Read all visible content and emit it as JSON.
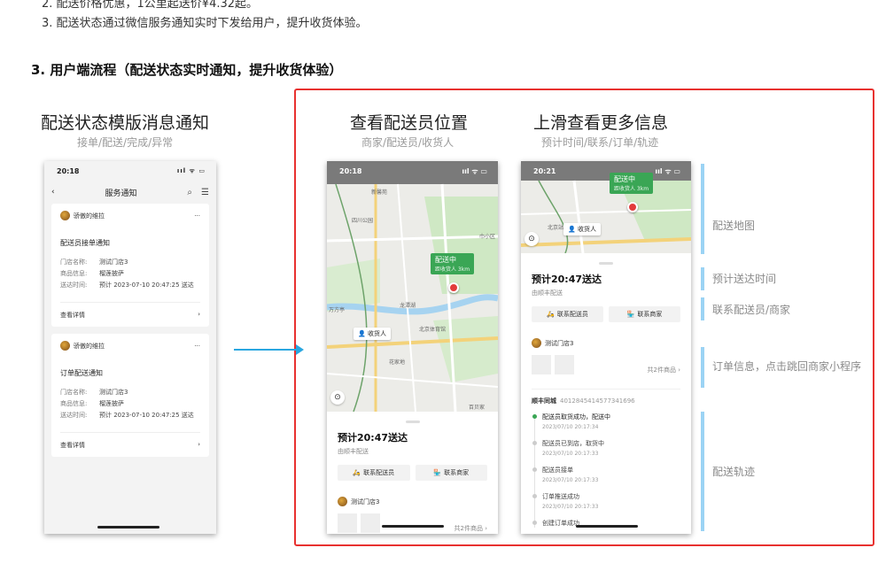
{
  "intro_list": [
    "2. 配送价格优惠，1公里起送价¥4.32起。",
    "3. 配送状态通过微信服务通知实时下发给用户，提升收货体验。"
  ],
  "section_heading": "3. 用户端流程（配送状态实时通知，提升收货体验）",
  "columns": [
    {
      "title": "配送状态模版消息通知",
      "subtitle": "接单/配送/完成/异常"
    },
    {
      "title": "查看配送员位置",
      "subtitle": "商家/配送员/收货人"
    },
    {
      "title": "上滑查看更多信息",
      "subtitle": "预计时间/联系/订单/轨迹"
    }
  ],
  "phone1": {
    "time": "20:18",
    "status_icons": "ııl ᯤ ▭",
    "nav_title": "服务通知",
    "cards": [
      {
        "sender": "骄傲的维拉",
        "more": "···",
        "title": "配送员接单通知",
        "fields": [
          {
            "k": "门店名称:",
            "v": "测试门店3"
          },
          {
            "k": "商品信息:",
            "v": "榴莲披萨"
          },
          {
            "k": "送达时间:",
            "v": "预计 2023-07-10 20:47:25 送达"
          }
        ],
        "footer": "查看详情"
      },
      {
        "sender": "骄傲的维拉",
        "more": "···",
        "title": "订单配送通知",
        "fields": [
          {
            "k": "门店名称:",
            "v": "测试门店3"
          },
          {
            "k": "商品信息:",
            "v": "榴莲披萨"
          },
          {
            "k": "送达时间:",
            "v": "预计 2023-07-10 20:47:25 送达"
          }
        ],
        "footer": "查看详情"
      }
    ]
  },
  "phone2": {
    "time": "20:18",
    "status_icons": "ııl ᯤ ▭",
    "badge_title": "配送中",
    "badge_sub": "距收货人 3km",
    "receiver": "收货人",
    "map_labels": [
      "新馨苑",
      "四川公园",
      "巾小区",
      "龙潭湖",
      "北京体育馆",
      "花家地",
      "万方亭",
      "百贝家"
    ],
    "eta": "预计20:47送达",
    "eta_sub": "由顺丰配送",
    "btn_rider": "联系配送员",
    "btn_merchant": "联系商家",
    "store": "测试门店3",
    "goods_count": "共2件商品 ›"
  },
  "phone3": {
    "time": "20:21",
    "status_icons": "ııl ᯤ ▭",
    "badge_title": "配送中",
    "badge_sub": "距收货人 3km",
    "receiver": "收货人",
    "map_labels": [
      "北京站"
    ],
    "eta": "预计20:47送达",
    "eta_sub": "由顺丰配送",
    "btn_rider": "联系配送员",
    "btn_merchant": "联系商家",
    "store": "测试门店3",
    "goods_count": "共2件商品 ›",
    "order_label": "顺丰同城",
    "order_no": "4012845414577341696",
    "track": [
      {
        "title": "配送员取货成功，配送中",
        "date": "2023/07/10 20:17:34",
        "active": true
      },
      {
        "title": "配送员已到店，取货中",
        "date": "2023/07/10 20:17:33",
        "active": false
      },
      {
        "title": "配送员接单",
        "date": "2023/07/10 20:17:33",
        "active": false
      },
      {
        "title": "订单推送成功",
        "date": "2023/07/10 20:17:33",
        "active": false
      },
      {
        "title": "创建订单成功",
        "date": "",
        "active": false
      }
    ]
  },
  "annotations": [
    "配送地图",
    "预计送达时间",
    "联系配送员/商家",
    "订单信息，点击跳回商家小程序",
    "配送轨迹"
  ],
  "colors": {
    "frame": "#e8312f",
    "arrow": "#2aa7e0",
    "annotation_bar": "#9bd3f4",
    "badge_green": "#3aa655"
  }
}
